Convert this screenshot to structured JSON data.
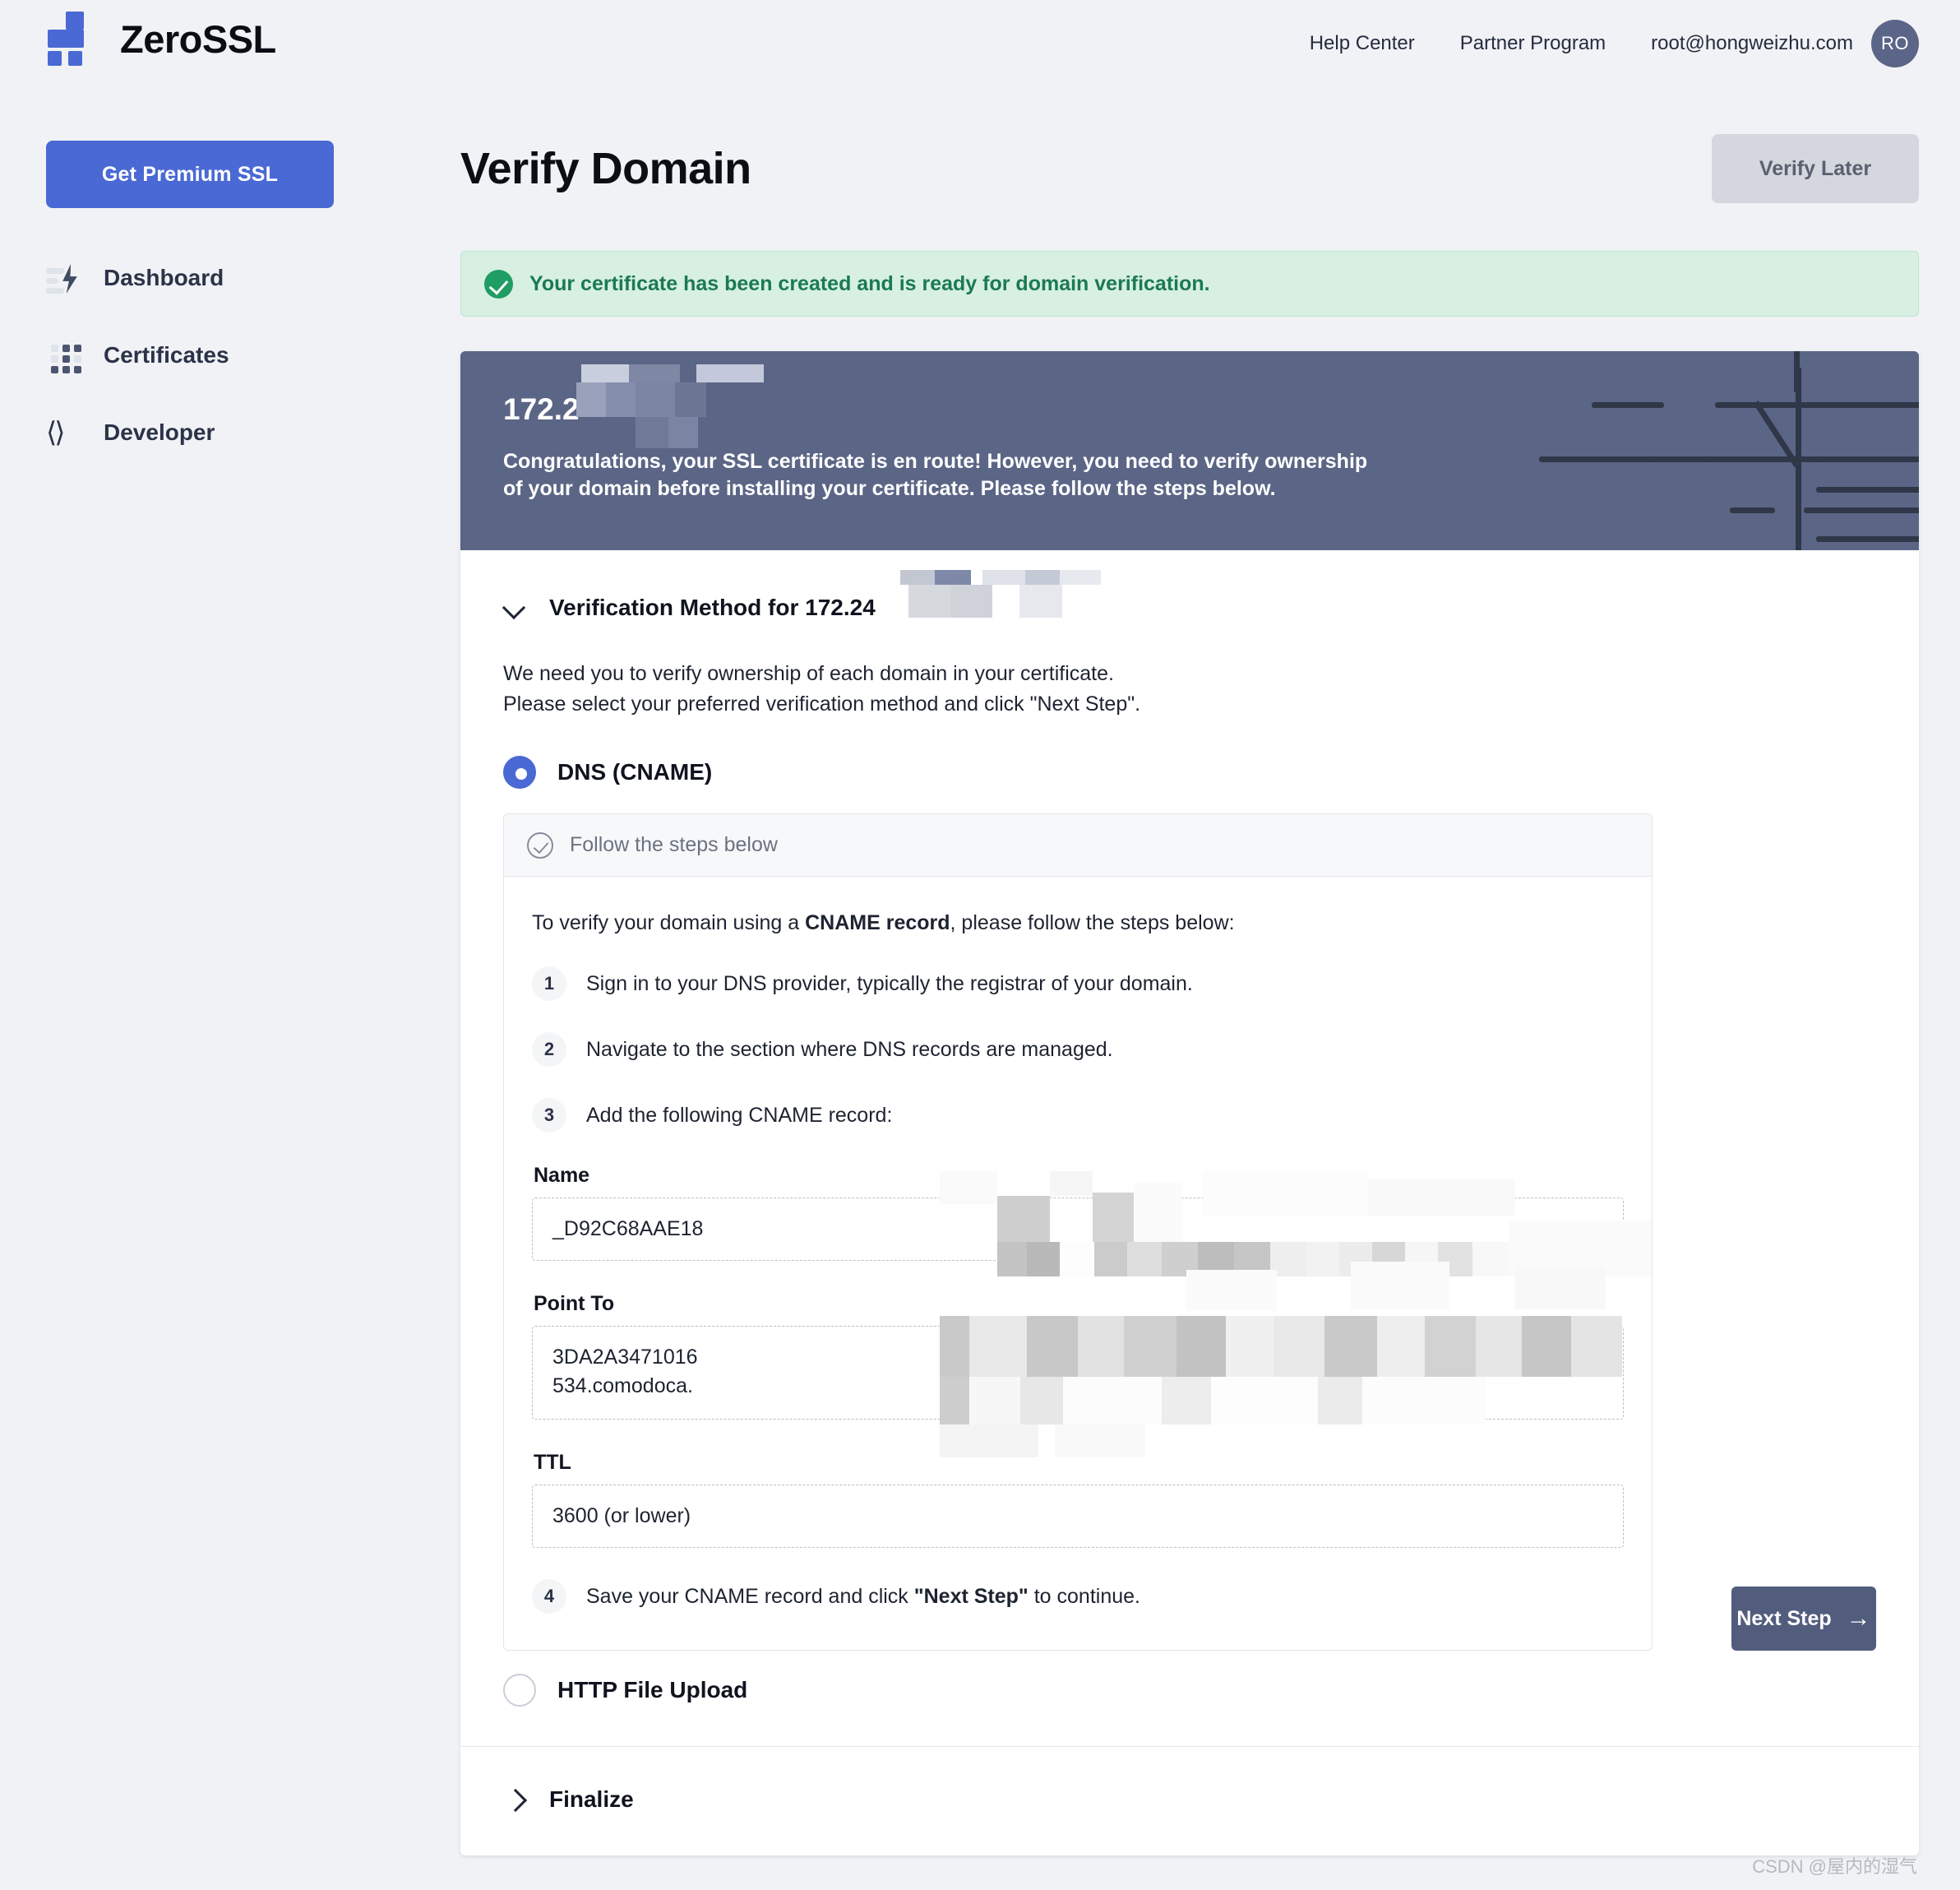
{
  "brand": {
    "name": "ZeroSSL",
    "logo_icon": "zerossl-cross-logo"
  },
  "topnav": {
    "help_center": "Help Center",
    "partner_program": "Partner Program",
    "account_email": "root@hongweizhu.com",
    "avatar_initials": "RO"
  },
  "sidebar": {
    "premium_button": "Get Premium SSL",
    "items": [
      {
        "label": "Dashboard",
        "icon": "dashboard-icon"
      },
      {
        "label": "Certificates",
        "icon": "grid-icon"
      },
      {
        "label": "Developer",
        "icon": "code-brackets-icon"
      }
    ]
  },
  "page": {
    "title": "Verify Domain",
    "verify_later_button": "Verify Later"
  },
  "alert": {
    "icon": "check-circle-icon",
    "message": "Your certificate has been created and is ready for domain verification."
  },
  "hero": {
    "domain": "172.2",
    "domain_redacted": true,
    "description_line1": "Congratulations, your SSL certificate is en route! However, you need to verify ownership",
    "description_line2": "of your domain before installing your certificate. Please follow the steps below."
  },
  "verification": {
    "section_title": "Verification Method for 172.24",
    "section_title_redacted": true,
    "intro_line1": "We need you to verify ownership of each domain in your certificate.",
    "intro_line2": "Please select your preferred verification method and click \"Next Step\".",
    "methods": [
      {
        "label": "DNS (CNAME)",
        "selected": true
      },
      {
        "label": "HTTP File Upload",
        "selected": false
      }
    ],
    "steps_box": {
      "header": "Follow the steps below",
      "header_icon": "check-circle-outline-icon",
      "intro_prefix": "To verify your domain using a ",
      "intro_bold": "CNAME record",
      "intro_suffix": ", please follow the steps below:",
      "steps": [
        {
          "num": "1",
          "text": "Sign in to your DNS provider, typically the registrar of your domain."
        },
        {
          "num": "2",
          "text": "Navigate to the section where DNS records are managed."
        },
        {
          "num": "3",
          "text": "Add the following CNAME record:"
        }
      ],
      "final_step": {
        "num": "4",
        "prefix": "Save your CNAME record and click ",
        "bold": "\"Next Step\"",
        "suffix": " to continue."
      },
      "fields": [
        {
          "label": "Name",
          "value": "_D92C68AAE18",
          "redacted": true
        },
        {
          "label": "Point To",
          "value": "3DA2A3471016",
          "value_line2": "534.comodoca.",
          "redacted": true
        },
        {
          "label": "TTL",
          "value": "3600 (or lower)",
          "redacted": false
        }
      ]
    }
  },
  "next_step_button": {
    "label": "Next Step",
    "icon": "arrow-right-icon"
  },
  "finalize": {
    "label": "Finalize",
    "icon": "chevron-right-icon"
  },
  "watermark": "CSDN @屋内的湿气",
  "colors": {
    "accent_blue": "#4a69d4",
    "hero_slate": "#5b6586",
    "alert_green_bg": "#d7f0e2",
    "alert_green_text": "#1b7a52",
    "next_btn": "#525d7e"
  }
}
